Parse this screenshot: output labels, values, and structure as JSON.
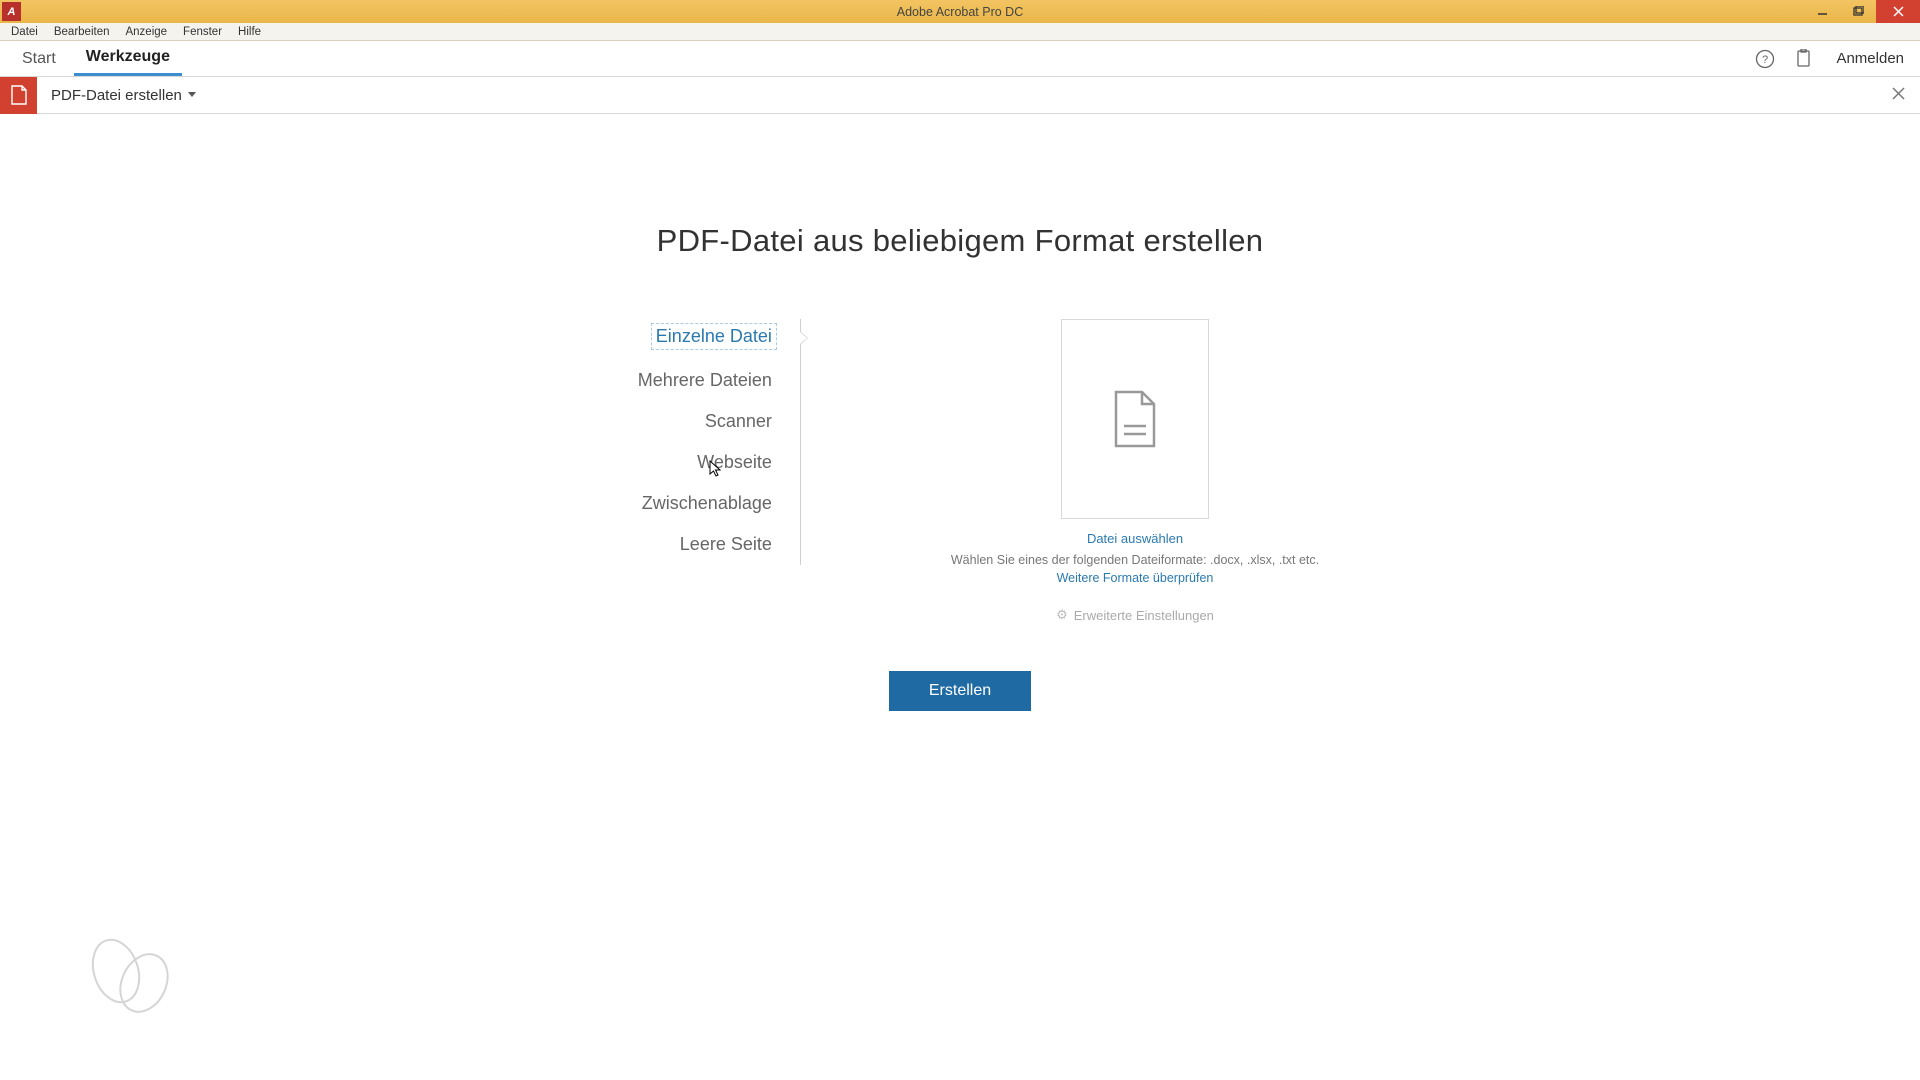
{
  "titlebar": {
    "app_title": "Adobe Acrobat Pro DC"
  },
  "menubar": {
    "items": [
      "Datei",
      "Bearbeiten",
      "Anzeige",
      "Fenster",
      "Hilfe"
    ]
  },
  "tabs": {
    "start": "Start",
    "tools": "Werkzeuge",
    "signin": "Anmelden"
  },
  "tool": {
    "title": "PDF-Datei erstellen"
  },
  "main": {
    "heading": "PDF-Datei aus beliebigem Format erstellen",
    "side_items": [
      "Einzelne Datei",
      "Mehrere Dateien",
      "Scanner",
      "Webseite",
      "Zwischenablage",
      "Leere Seite"
    ],
    "select_file": "Datei auswählen",
    "formats_hint": "Wählen Sie eines der folgenden Dateiformate: .docx, .xlsx, .txt etc.",
    "more_formats": "Weitere Formate überprüfen",
    "advanced": "Erweiterte Einstellungen",
    "create": "Erstellen"
  }
}
